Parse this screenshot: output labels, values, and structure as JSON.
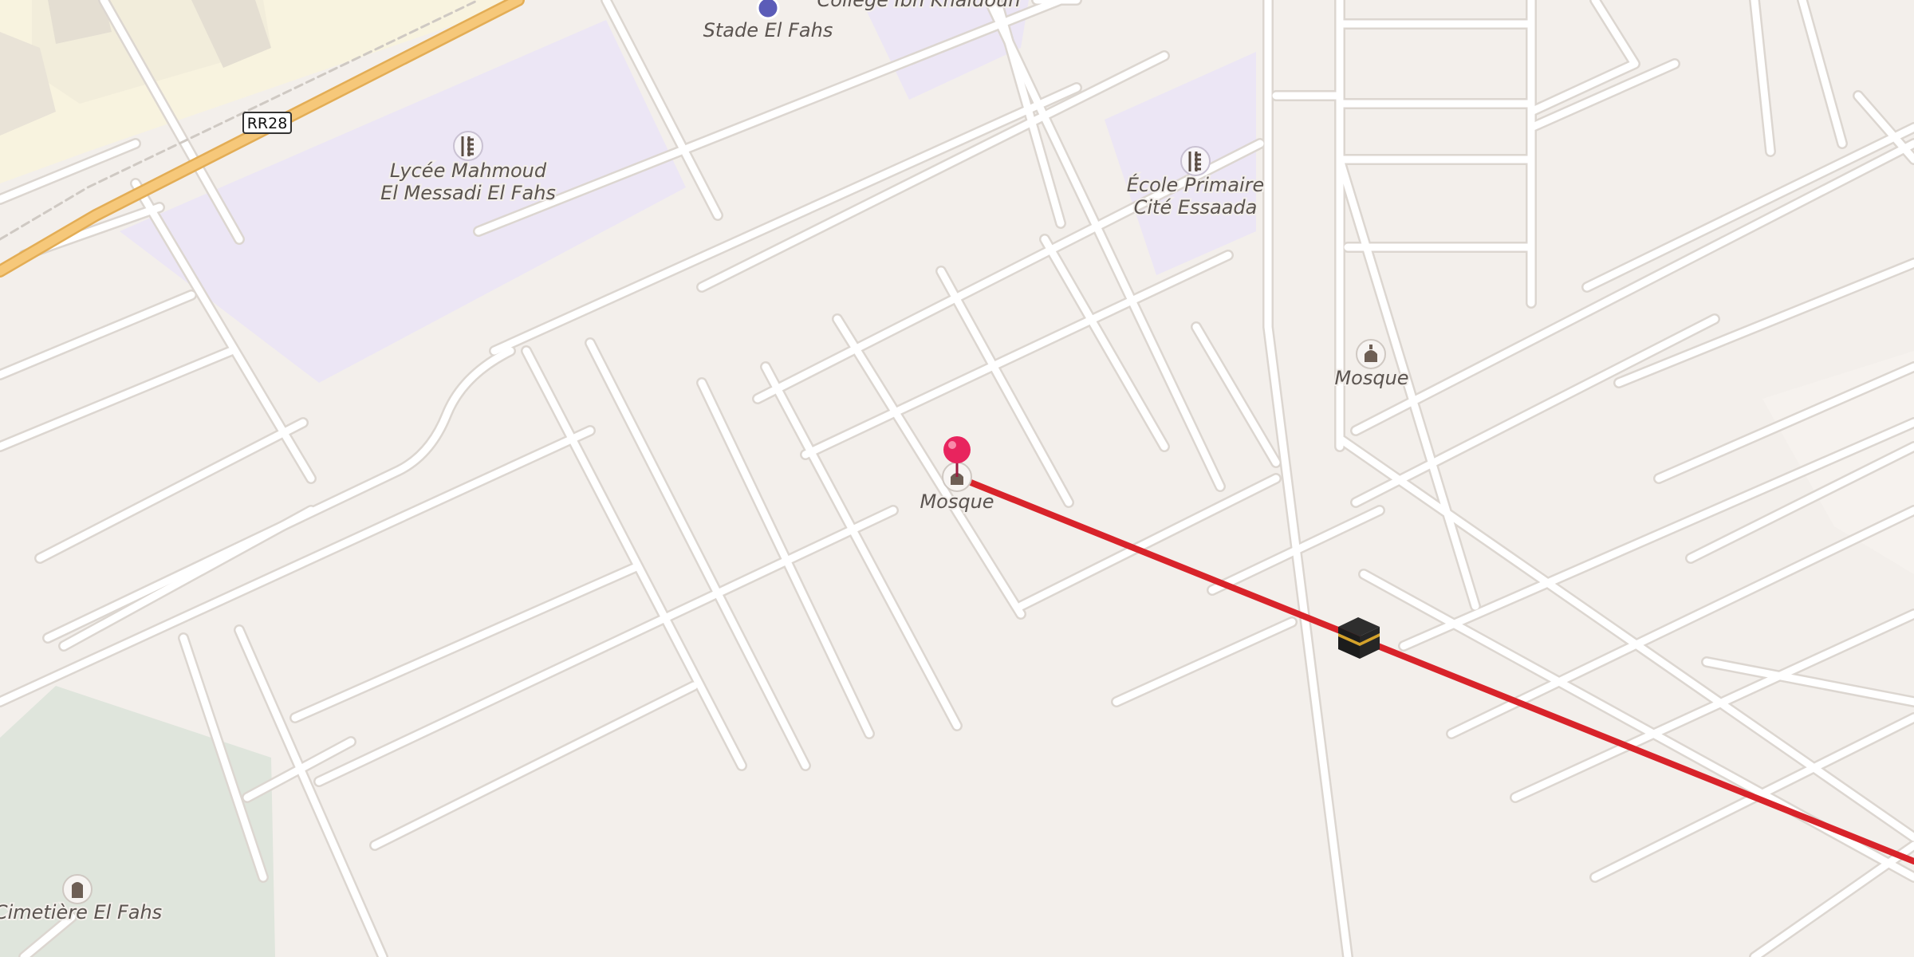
{
  "map": {
    "road_shield": {
      "label": "RR28"
    },
    "pois": [
      {
        "id": "stade",
        "name": "Stade El Fahs",
        "icon": "stadium-icon"
      },
      {
        "id": "college",
        "name": "Collège Ibn Khaldoun",
        "icon": "school-icon"
      },
      {
        "id": "lycee",
        "name_line1": "Lycée Mahmoud",
        "name_line2": "El Messadi El Fahs",
        "icon": "school-icon"
      },
      {
        "id": "ecole",
        "name_line1": "École Primaire",
        "name_line2": "Cité Essaada",
        "icon": "school-icon"
      },
      {
        "id": "mosque1",
        "name": "Mosque",
        "icon": "mosque-icon"
      },
      {
        "id": "mosque2",
        "name": "Mosque",
        "icon": "mosque-icon"
      },
      {
        "id": "cemetery",
        "name": "Cimetière El Fahs",
        "icon": "cemetery-icon"
      }
    ],
    "markers": {
      "location_pin": "location-pin-icon",
      "kaaba": "kaaba-icon"
    },
    "colors": {
      "background": "#f3efeb",
      "road": "#ffffff",
      "road_casing": "#dcd6d0",
      "school_area": "#ece6f5",
      "cemetery_area": "#dfe5dc",
      "main_road": "#f6c87a",
      "built_area": "#f8f3df",
      "qibla_line": "#d8232a",
      "pin": "#e8245e"
    }
  }
}
